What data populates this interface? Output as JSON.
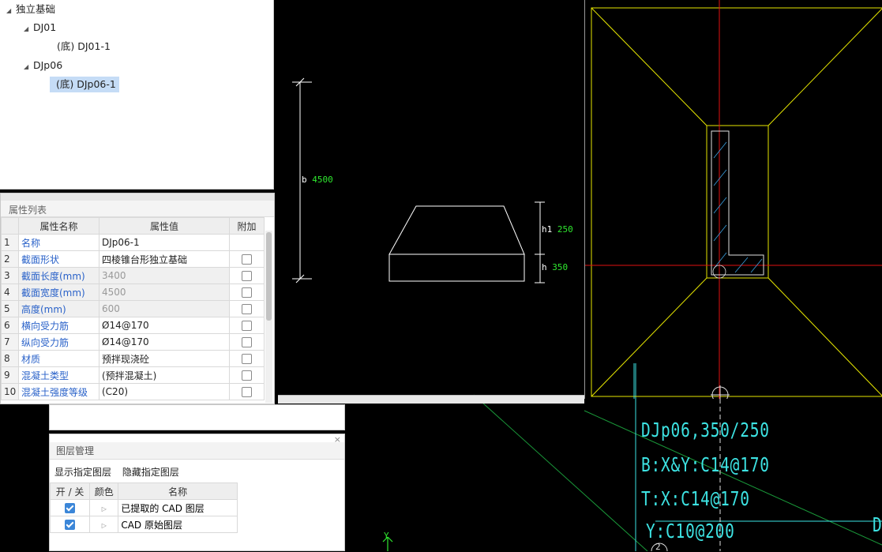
{
  "tree": {
    "root": "独立基础",
    "nodes": [
      {
        "label": "DJ01",
        "children": [
          {
            "label": "(底) DJ01-1"
          }
        ]
      },
      {
        "label": "DJp06",
        "children": [
          {
            "label": "(底) DJp06-1",
            "selected": true
          }
        ]
      }
    ]
  },
  "properties": {
    "title": "属性列表",
    "columns": [
      "属性名称",
      "属性值",
      "附加"
    ],
    "rows": [
      {
        "idx": "1",
        "name": "名称",
        "value": "DJp06-1",
        "checkbox": false,
        "gray": false
      },
      {
        "idx": "2",
        "name": "截面形状",
        "value": "四棱锥台形独立基础",
        "checkbox": true,
        "gray": false
      },
      {
        "idx": "3",
        "name": "截面长度(mm)",
        "value": "3400",
        "checkbox": true,
        "gray": true
      },
      {
        "idx": "4",
        "name": "截面宽度(mm)",
        "value": "4500",
        "checkbox": true,
        "gray": true
      },
      {
        "idx": "5",
        "name": "高度(mm)",
        "value": "600",
        "checkbox": true,
        "gray": true
      },
      {
        "idx": "6",
        "name": "横向受力筋",
        "value": "Ø14@170",
        "checkbox": true,
        "gray": false
      },
      {
        "idx": "7",
        "name": "纵向受力筋",
        "value": "Ø14@170",
        "checkbox": true,
        "gray": false
      },
      {
        "idx": "8",
        "name": "材质",
        "value": "预拌现浇砼",
        "checkbox": true,
        "gray": false
      },
      {
        "idx": "9",
        "name": "混凝土类型",
        "value": "(预拌混凝土)",
        "checkbox": true,
        "gray": false
      },
      {
        "idx": "10",
        "name": "混凝土强度等级",
        "value": "(C20)",
        "checkbox": true,
        "gray": false
      }
    ]
  },
  "layers": {
    "title": "图层管理",
    "close": "×",
    "show_action": "显示指定图层",
    "hide_action": "隐藏指定图层",
    "columns": [
      "开 / 关",
      "颜色",
      "名称"
    ],
    "rows": [
      {
        "name": "已提取的 CAD 图层",
        "on": true
      },
      {
        "name": "CAD 原始图层",
        "on": true
      }
    ]
  },
  "section_dims": {
    "b_tag": "b",
    "b_val": "4500",
    "h1_tag": "h1",
    "h1_val": "250",
    "h_tag": "h",
    "h_val": "350"
  },
  "cad_text": {
    "line1": "DJp06,350/250",
    "line2": "B:X&Y:C14@170",
    "line3": "T:X:C14@170",
    "line4": "Y:C10@200",
    "edge_char": "D",
    "axis_y": "Y",
    "axis_num": "2"
  },
  "colors": {
    "cad_background": "#000000",
    "cad_yellow": "#e6e600",
    "cad_red": "#e01010",
    "cad_cyan": "#3de3e3",
    "cad_green": "#2fe82f",
    "selection": "#c5dcf6",
    "property_name": "#2a62c9"
  }
}
